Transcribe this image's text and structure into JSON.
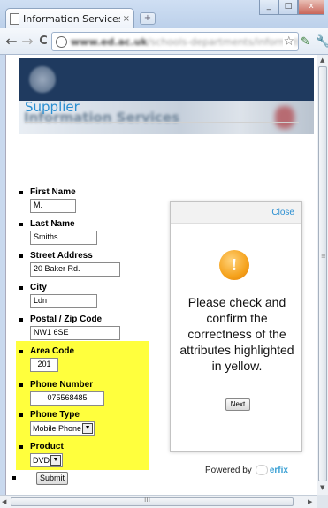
{
  "browser": {
    "tab_title": "Information Services | I...",
    "tab_close": "×",
    "new_tab": "+",
    "window_buttons": [
      "_",
      "□",
      "x"
    ],
    "back": "←",
    "forward": "→",
    "reload": "C",
    "url_host": "www.ed.ac.uk",
    "url_path": "/schools-departments/informati",
    "bookmark_star": "☆",
    "wrench_icon": "✎"
  },
  "header": {
    "site_banner_text": "Information Services"
  },
  "page": {
    "heading": "Supplier"
  },
  "form": {
    "first_name": {
      "label": "First Name",
      "value": "M."
    },
    "last_name": {
      "label": "Last Name",
      "value": "Smiths"
    },
    "street_address": {
      "label": "Street Address",
      "value": "20 Baker Rd."
    },
    "city": {
      "label": "City",
      "value": "Ldn"
    },
    "postal_code": {
      "label": "Postal / Zip Code",
      "value": "NW1 6SE"
    },
    "area_code": {
      "label": "Area Code",
      "value": "201"
    },
    "phone_number": {
      "label": "Phone Number",
      "value": "075568485"
    },
    "phone_type": {
      "label": "Phone Type",
      "value": "Mobile Phone"
    },
    "product": {
      "label": "Product",
      "value": "DVD"
    },
    "submit_label": "Submit",
    "highlight_color": "#ffff3d"
  },
  "popup": {
    "close_label": "Close",
    "icon": "warning-exclamation",
    "icon_glyph": "!",
    "message": "Please check and confirm the correctness of the attributes highlighted in yellow.",
    "next_label": "Next",
    "powered_by": "Powered by",
    "brand": "erfix"
  },
  "scrollbar": {
    "up": "▲",
    "down": "▼",
    "left": "◀",
    "right": "▶",
    "grip": "≡",
    "hgrip": "III"
  }
}
